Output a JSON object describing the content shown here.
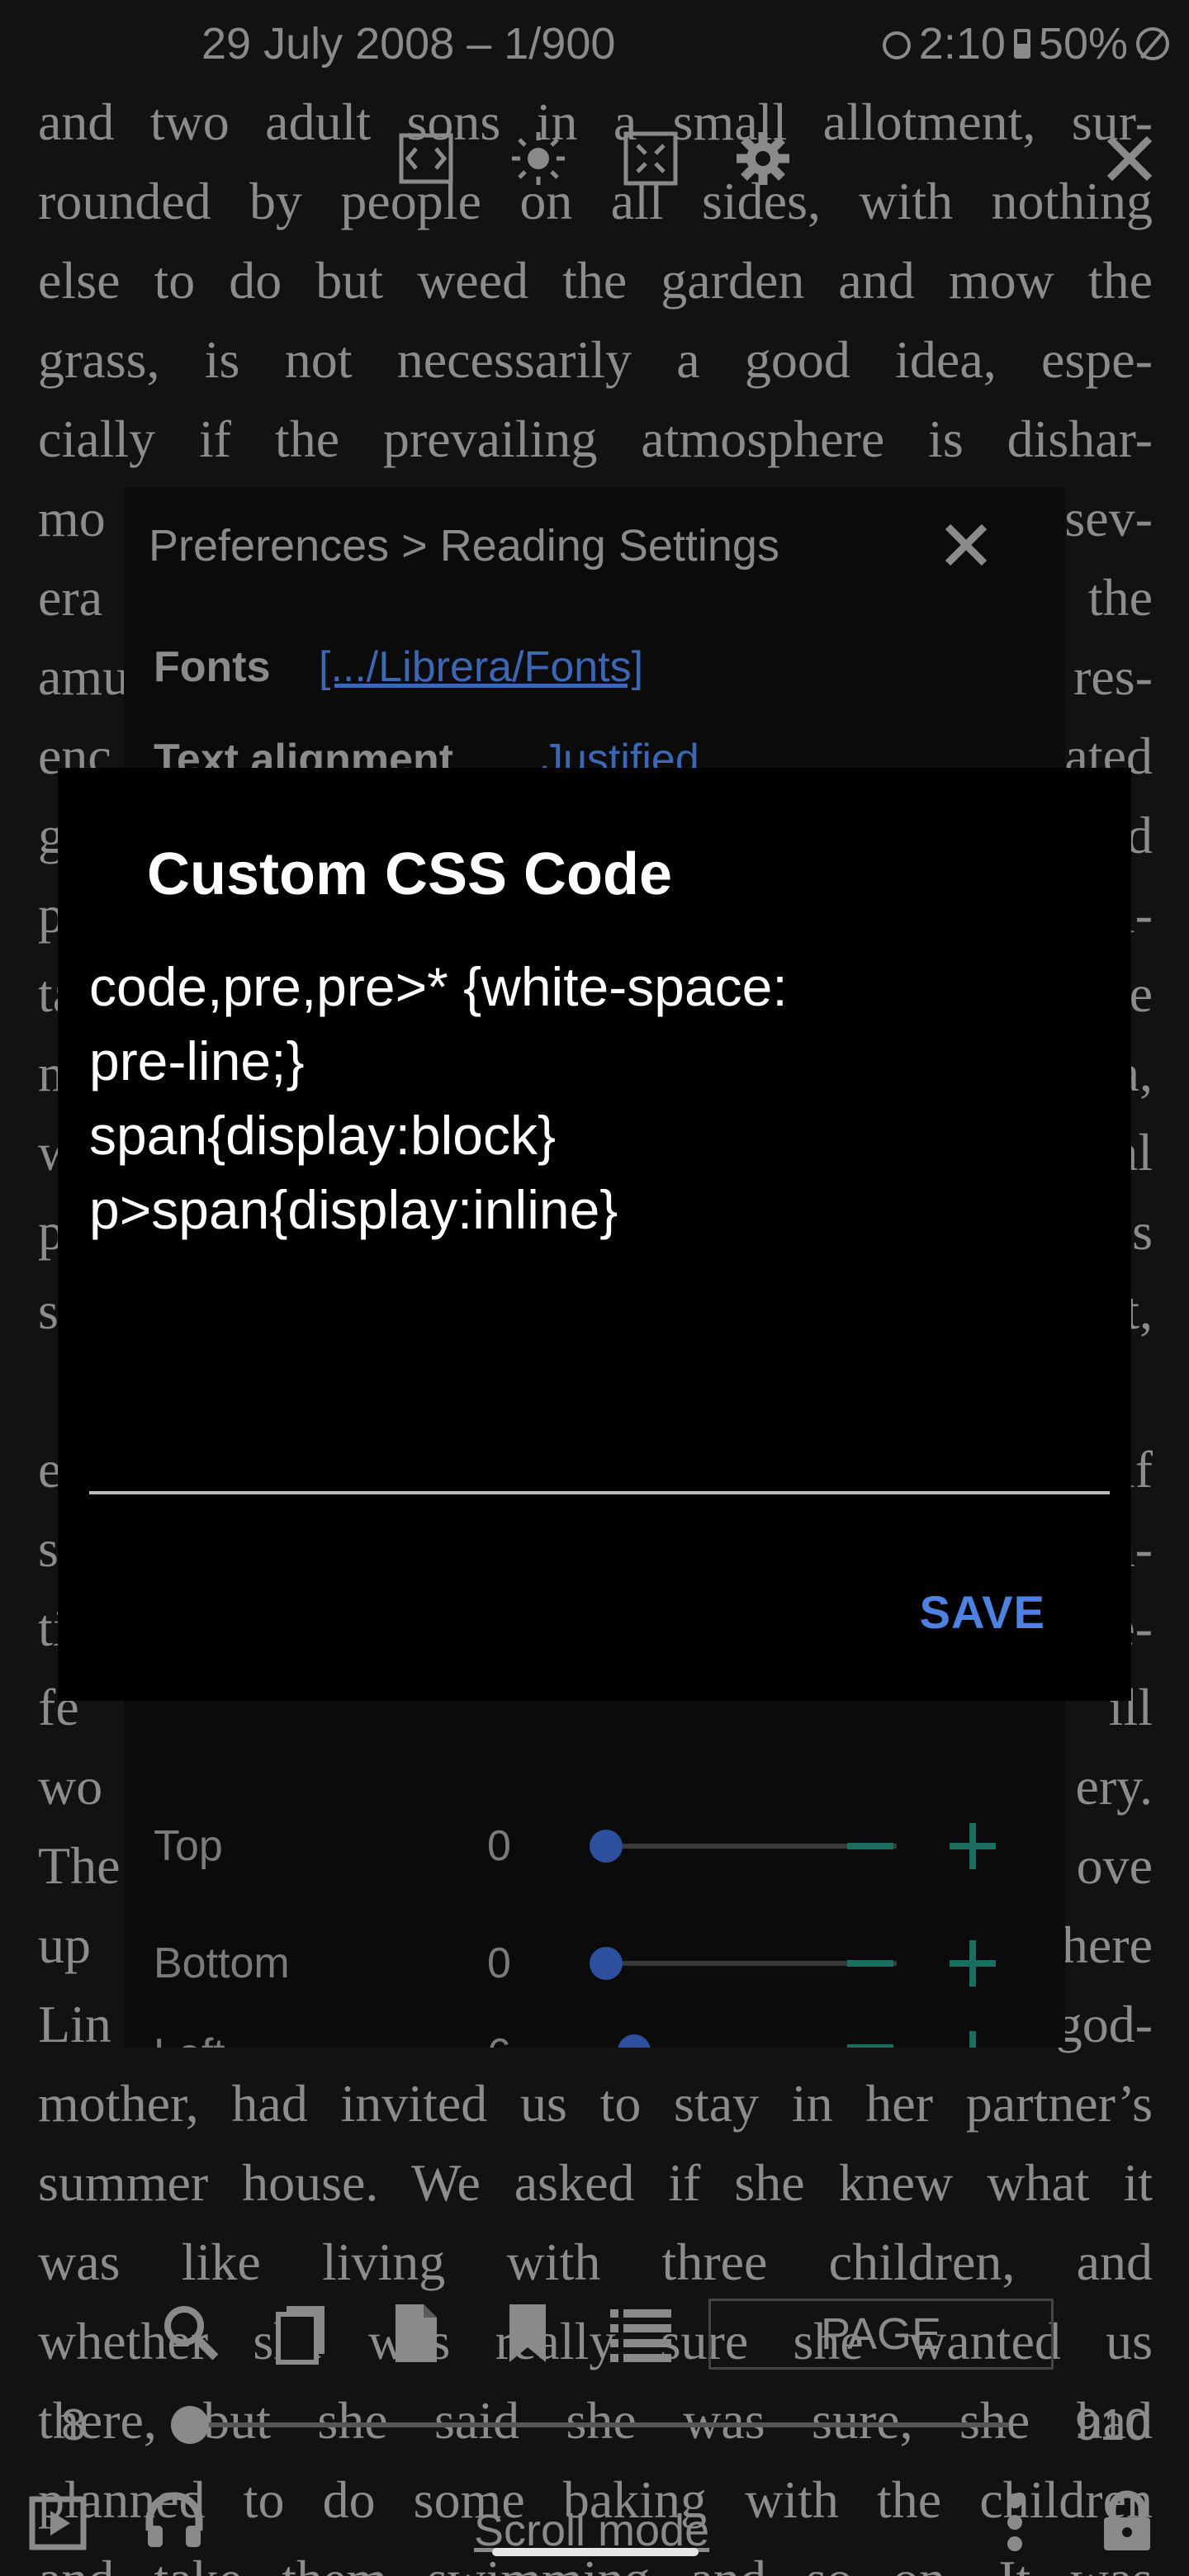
{
  "status_bar": {
    "date_page": "29 July 2008 – 1/900",
    "time": "2:10",
    "battery": "50%"
  },
  "book_lines": [
    "and two adult sons in a small allotment, sur-",
    "rounded by people on all sides, with nothing",
    "else to do but weed the garden and mow the",
    "grass, is not necessarily a good idea, espe-",
    "cially if the prevailing atmosphere is dishar-",
    "mo",
    "era",
    "amu",
    "enc",
    "ga",
    "pe",
    "ta",
    "m",
    "w",
    "pi",
    "sh",
    "",
    "ev",
    "sh",
    "tio",
    "fe",
    "wo",
    "The",
    "up",
    "Lin",
    "mother, had invited us to stay in her partner’s",
    "summer house. We asked if she knew what it",
    "was like living with three children, and",
    "whether she was really sure she wanted us",
    "there, but she said she was sure, she had",
    "planned to do some baking with the children",
    "and take them swimming and so on. It was"
  ],
  "book_right_fragments": [
    "sev-",
    "the",
    "res-",
    "ated",
    "ed",
    "ri-",
    "se",
    "a,",
    "al",
    "us",
    "st,",
    "",
    "if",
    "a-",
    "e-",
    "ill",
    "ery.",
    "ove",
    "here",
    "god-"
  ],
  "toolbar": {
    "fullscreen_icon": "fullscreen-icon",
    "brightness_icon": "brightness-icon",
    "crop_icon": "crop-icon",
    "settings_icon": "gear-icon",
    "close_icon": "close-icon"
  },
  "preferences": {
    "breadcrumb": "Preferences >  Reading Settings",
    "fonts_label": "Fonts",
    "fonts_path": "[.../Librera/Fonts]",
    "alignment_label": "Text alignment",
    "alignment_value": "Justified",
    "margins": [
      {
        "label": "Top",
        "value": "0",
        "level": 0
      },
      {
        "label": "Bottom",
        "value": "0",
        "level": 0
      },
      {
        "label": "Left",
        "value": "6",
        "level": 0.1
      }
    ]
  },
  "dialog": {
    "title": "Custom CSS Code",
    "code": "code,pre,pre>* {white-space:\npre-line;}\nspan{display:block}\np>span{display:inline}",
    "save_label": "SAVE"
  },
  "bottom": {
    "page_mode_label": "PAGE",
    "current_page": "8",
    "total_pages": "910",
    "progress": 0.008,
    "scroll_mode_label": "Scroll mode"
  },
  "colors": {
    "accent": "#4d82e2",
    "teal": "#1b6d60",
    "link": "#3b67b5"
  }
}
